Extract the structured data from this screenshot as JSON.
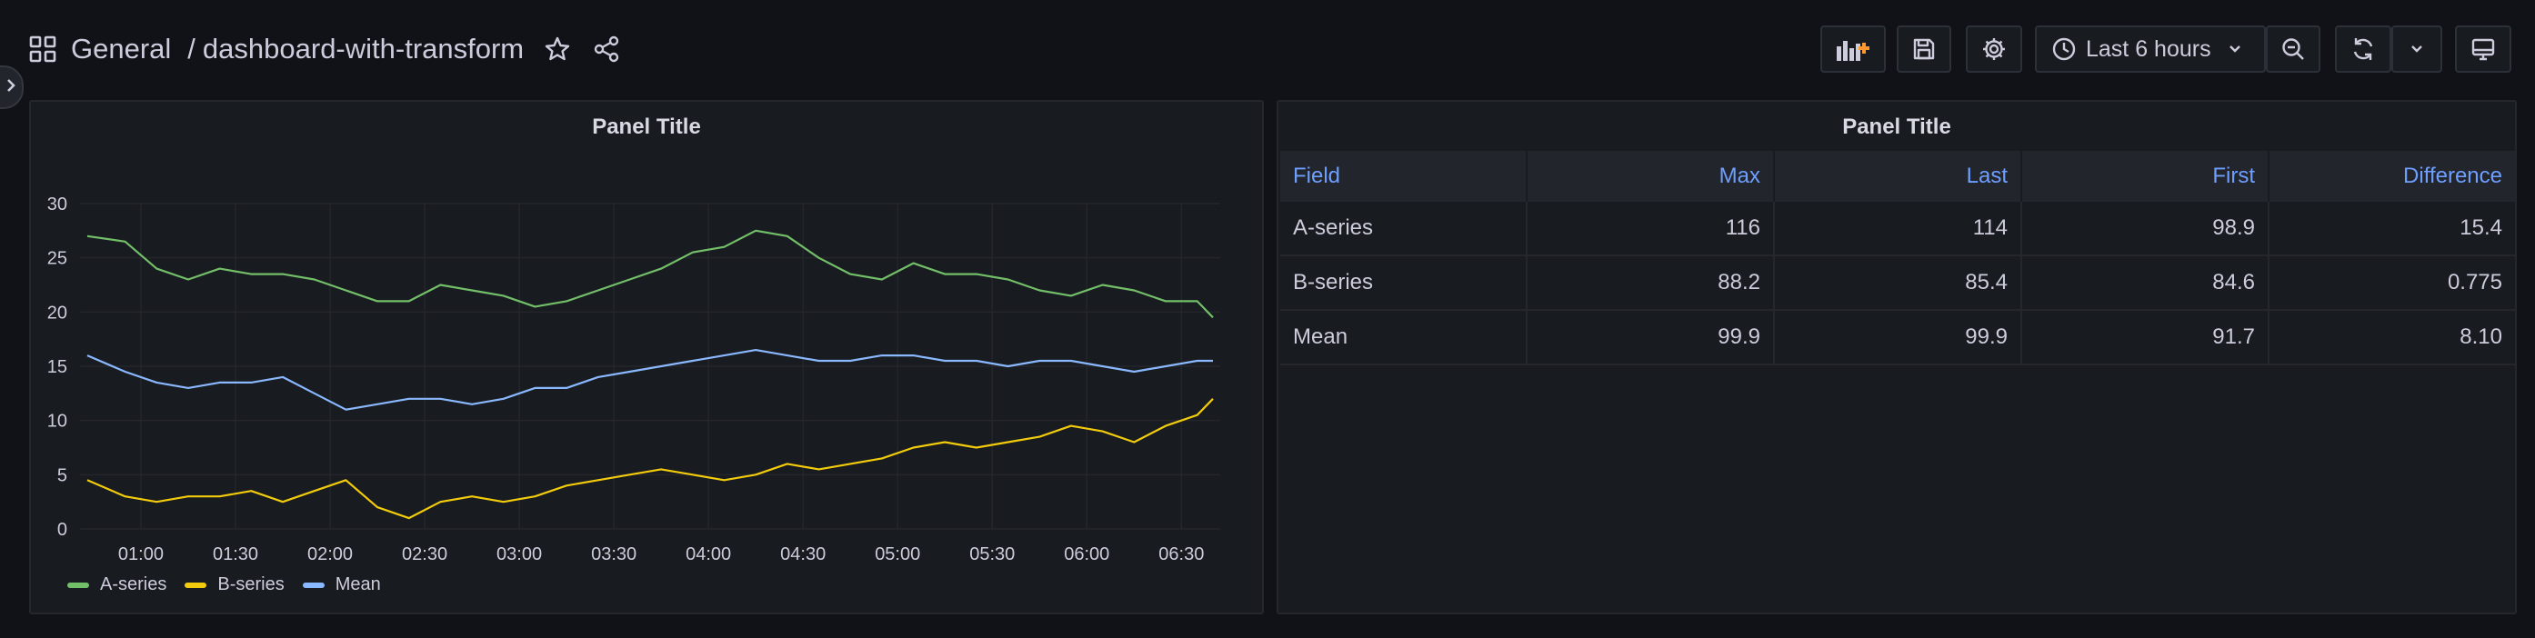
{
  "header": {
    "folder": "General",
    "separator": "/",
    "dashboard_title": "dashboard-with-transform"
  },
  "toolbar": {
    "time_range": "Last 6 hours",
    "icons": [
      "add-panel-icon",
      "save-icon",
      "gear-icon",
      "clock-icon",
      "zoom-out-icon",
      "refresh-icon",
      "chevron-down-icon",
      "tv-icon"
    ]
  },
  "colors": {
    "a_series": "#73bf69",
    "b_series": "#f2cc0c",
    "mean": "#8ab8ff",
    "link": "#6e9fff"
  },
  "left_panel": {
    "title": "Panel Title"
  },
  "right_panel": {
    "title": "Panel Title",
    "columns": [
      "Field",
      "Max",
      "Last",
      "First",
      "Difference"
    ],
    "rows": [
      [
        "A-series",
        "116",
        "114",
        "98.9",
        "15.4"
      ],
      [
        "B-series",
        "88.2",
        "85.4",
        "84.6",
        "0.775"
      ],
      [
        "Mean",
        "99.9",
        "99.9",
        "91.7",
        "8.10"
      ]
    ]
  },
  "chart_data": {
    "type": "line",
    "title": "Panel Title",
    "xlabel": "",
    "ylabel": "",
    "ylim": [
      0,
      30
    ],
    "yticks": [
      "0",
      "5",
      "10",
      "15",
      "20",
      "25",
      "30"
    ],
    "xticks": [
      "01:00",
      "01:30",
      "02:00",
      "02:30",
      "03:00",
      "03:30",
      "04:00",
      "04:30",
      "05:00",
      "05:30",
      "06:00",
      "06:30"
    ],
    "x": [
      "00:43",
      "00:55",
      "01:05",
      "01:15",
      "01:25",
      "01:35",
      "01:45",
      "01:55",
      "02:05",
      "02:15",
      "02:25",
      "02:35",
      "02:45",
      "02:55",
      "03:05",
      "03:15",
      "03:25",
      "03:35",
      "03:45",
      "03:55",
      "04:05",
      "04:15",
      "04:25",
      "04:35",
      "04:45",
      "04:55",
      "05:05",
      "05:15",
      "05:25",
      "05:35",
      "05:45",
      "05:55",
      "06:05",
      "06:15",
      "06:25",
      "06:35",
      "06:40"
    ],
    "legend": "bottom-left",
    "grid": true,
    "series": [
      {
        "name": "A-series",
        "values": [
          27,
          26.5,
          24,
          23,
          24,
          23.5,
          23.5,
          23,
          22,
          21,
          21,
          22.5,
          22,
          21.5,
          20.5,
          21,
          22,
          23,
          24,
          25.5,
          26,
          27.5,
          27,
          25,
          23.5,
          23,
          24.5,
          23.5,
          23.5,
          23,
          22,
          21.5,
          22.5,
          22,
          21,
          21,
          19.5
        ]
      },
      {
        "name": "B-series",
        "values": [
          4.5,
          3,
          2.5,
          3,
          3,
          3.5,
          2.5,
          3.5,
          4.5,
          2,
          1,
          2.5,
          3,
          2.5,
          3,
          4,
          4.5,
          5,
          5.5,
          5,
          4.5,
          5,
          6,
          5.5,
          6,
          6.5,
          7.5,
          8,
          7.5,
          8,
          8.5,
          9.5,
          9,
          8,
          9.5,
          10.5,
          12
        ]
      },
      {
        "name": "Mean",
        "values": [
          16,
          14.5,
          13.5,
          13,
          13.5,
          13.5,
          14,
          12.5,
          11,
          11.5,
          12,
          12,
          11.5,
          12,
          13,
          13,
          14,
          14.5,
          15,
          15.5,
          16,
          16.5,
          16,
          15.5,
          15.5,
          16,
          16,
          15.5,
          15.5,
          15,
          15.5,
          15.5,
          15,
          14.5,
          15,
          15.5,
          15.5
        ]
      }
    ]
  }
}
